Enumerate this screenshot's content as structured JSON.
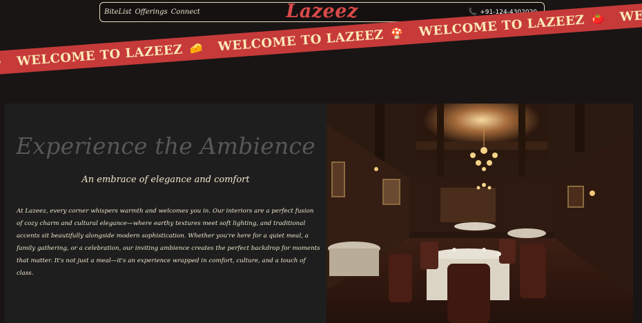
{
  "nav": {
    "links": [
      "BiteList",
      "Offerings",
      "Connect"
    ],
    "brand": "Lazeez",
    "phone": "+91-124-4302020"
  },
  "banner": {
    "items": [
      {
        "text": "WELCOME TO LAZEEZ",
        "icon": "chili-pepper-icon",
        "emoji": "🌶"
      },
      {
        "text": "WELCOME TO LAZEEZ",
        "icon": "cheese-icon",
        "emoji": "🧀"
      },
      {
        "text": "WELCOME TO LAZEEZ",
        "icon": "mushroom-icon",
        "emoji": "🍄"
      },
      {
        "text": "WELCOME TO LAZEEZ",
        "icon": "tomato-icon",
        "emoji": "🍅"
      },
      {
        "text": "WELCOME",
        "icon": "",
        "emoji": ""
      }
    ],
    "color": "#c63a3a"
  },
  "main": {
    "headline": "Experience the Ambience",
    "subhead": "An embrace of elegance and comfort",
    "body": "At Lazeez, every corner whispers warmth and welcomes you in. Our interiors are a perfect fusion of cozy charm and cultural elegance—where earthy textures meet soft lighting, and traditional accents sit beautifully alongside modern sophistication. Whether you're here for a quiet meal, a family gathering, or a celebration, our inviting ambience creates the perfect backdrop for moments that matter. It's not just a meal—it's an experience wrapped in comfort, culture, and a touch of class."
  },
  "colors": {
    "background": "#191514",
    "accent": "#d94a4a",
    "panel": "#1e1e1e"
  }
}
